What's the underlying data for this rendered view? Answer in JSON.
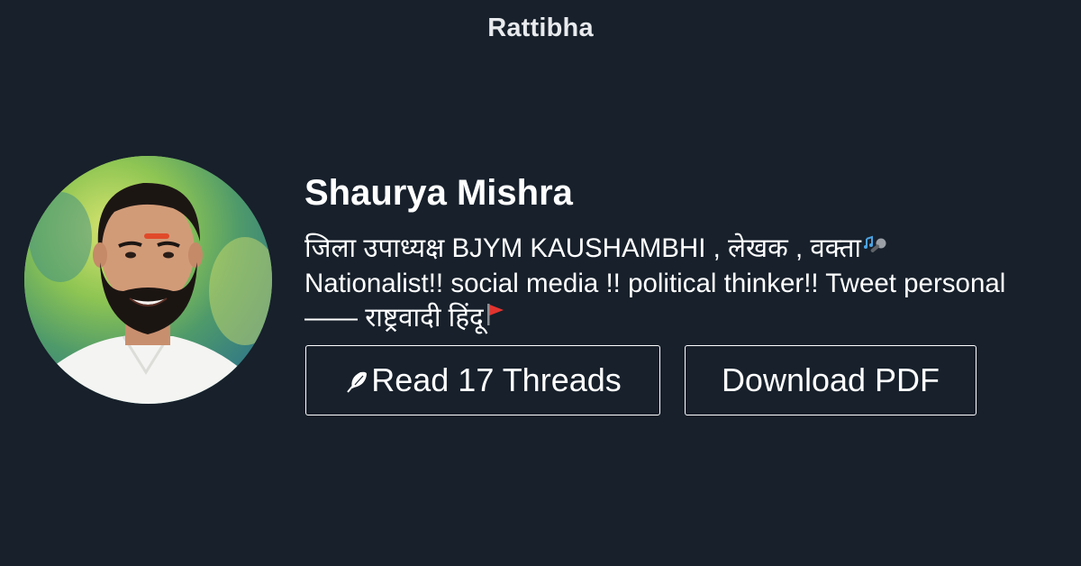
{
  "header": {
    "brand": "Rattibha"
  },
  "profile": {
    "name": "Shaurya Mishra",
    "avatar_icon": "profile-photo",
    "bio_line_1": "जिला उपाध्यक्ष BJYM KAUSHAMBHI , लेखक , वक्ता",
    "bio_line_2": "Nationalist!! social media !! political thinker!! Tweet personal",
    "bio_line_3": "—— राष्ट्रवादी हिंदू",
    "bio_emoji_1": "microphone-music-icon",
    "bio_emoji_2": "red-flag-icon"
  },
  "actions": {
    "read_label": "Read 17 Threads",
    "read_icon": "feather-icon",
    "download_label": "Download PDF"
  }
}
